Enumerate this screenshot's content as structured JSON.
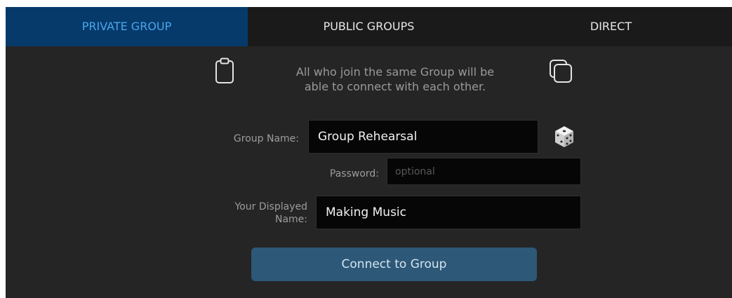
{
  "tabs": [
    {
      "label": "PRIVATE GROUP",
      "active": true
    },
    {
      "label": "PUBLIC GROUPS",
      "active": false
    },
    {
      "label": "DIRECT",
      "active": false
    }
  ],
  "info": {
    "line1": "All who join the same Group will be",
    "line2": "able to connect with each other."
  },
  "icons": {
    "left": "clipboard-icon",
    "right": "copy-icon",
    "random": "dice-icon"
  },
  "form": {
    "group_name_label": "Group Name:",
    "group_name_value": "Group Rehearsal",
    "password_label": "Password:",
    "password_placeholder": "optional",
    "display_name_label_1": "Your Displayed",
    "display_name_label_2": "Name:",
    "display_name_value": "Making Music"
  },
  "connect_label": "Connect to Group",
  "colors": {
    "background": "#252525",
    "tab_bar": "#1a1a1a",
    "active_tab": "#063a6b",
    "active_tab_text": "#4aa6ea",
    "button": "#2d5878"
  }
}
